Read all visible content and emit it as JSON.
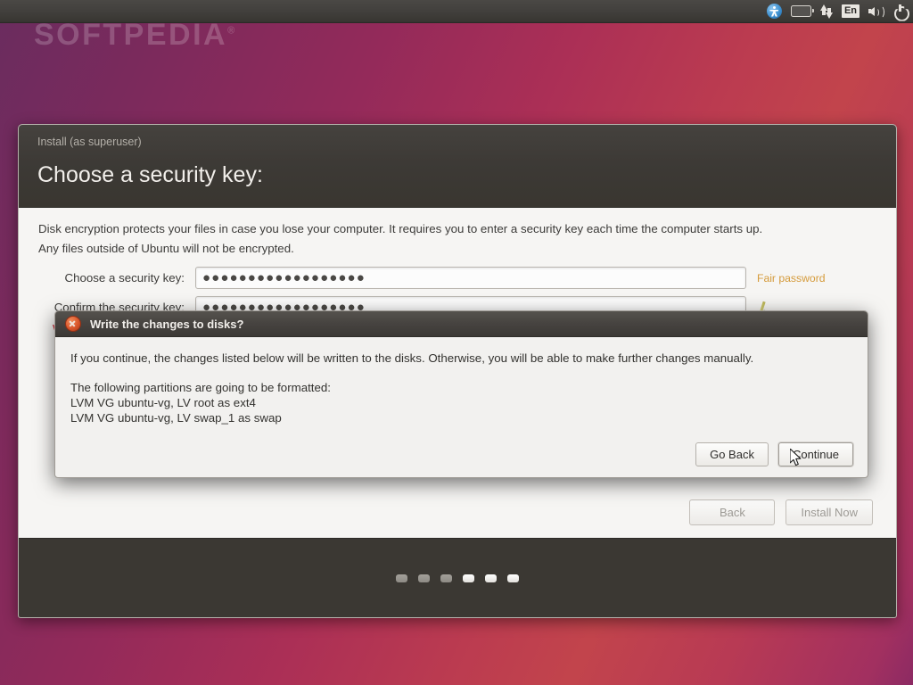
{
  "watermark": {
    "text": "SOFTPEDIA",
    "trademark": "®"
  },
  "panel": {
    "indicators": [
      {
        "name": "accessibility-icon",
        "label": "Accessibility"
      },
      {
        "name": "battery-icon",
        "label": "Battery"
      },
      {
        "name": "network-icon",
        "label": "Network"
      },
      {
        "name": "keyboard-layout-indicator",
        "label": "En"
      },
      {
        "name": "volume-icon",
        "label": "Volume"
      },
      {
        "name": "power-icon",
        "label": "Power"
      }
    ],
    "keyboard_layout": "En"
  },
  "installer": {
    "window_title": "Install (as superuser)",
    "page_heading": "Choose a security key:",
    "intro_line_1": "Disk encryption protects your files in case you lose your computer. It requires you to enter a security key each time the computer starts up.",
    "intro_line_2": "Any files outside of Ubuntu will not be encrypted.",
    "fields": [
      {
        "label": "Choose a security key:",
        "value": "●●●●●●●●●●●●●●●●●●",
        "placeholder": "",
        "strength": "Fair password",
        "strength_color": "#d59b3c"
      },
      {
        "label": "Confirm the security key:",
        "value": "●●●●●●●●●●●●●●●●●●",
        "placeholder": "",
        "strength": "",
        "strength_color": ""
      }
    ],
    "warning_text": "W",
    "buttons": {
      "back": "Back",
      "install_now": "Install Now"
    },
    "progress_dots": {
      "total": 6,
      "active_index": 3
    }
  },
  "dialog": {
    "title": "Write the changes to disks?",
    "body_line_1": "If you continue, the changes listed below will be written to the disks. Otherwise, you will be able to make further changes manually.",
    "body_line_2": "The following partitions are going to be formatted:",
    "partitions": [
      "LVM VG ubuntu-vg, LV root as ext4",
      "LVM VG ubuntu-vg, LV swap_1 as swap"
    ],
    "buttons": {
      "go_back": "Go Back",
      "continue": "Continue"
    }
  },
  "colors": {
    "desktop_gradient_start": "#6a2c5f",
    "desktop_gradient_end": "#c2444c",
    "panel": "#413f3c",
    "installer_titlebar": "#3d3a36",
    "accent_orange": "#d9562b",
    "warning_red": "#cc1f2e"
  }
}
